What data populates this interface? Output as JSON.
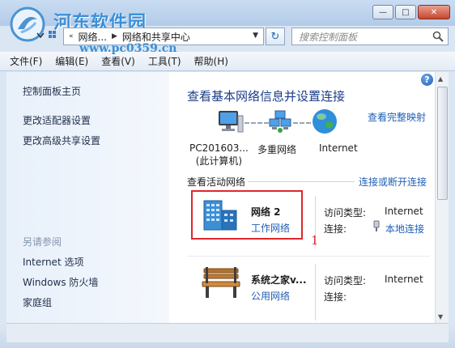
{
  "watermark": {
    "site_name": "河东软件园",
    "url": "www.pc0359.cn"
  },
  "window": {
    "minimize": "—",
    "maximize": "□",
    "close": "✕"
  },
  "address": {
    "segments": [
      "网络...",
      "网络和共享中心"
    ],
    "search_placeholder": "搜索控制面板"
  },
  "menu": [
    "文件(F)",
    "编辑(E)",
    "查看(V)",
    "工具(T)",
    "帮助(H)"
  ],
  "sidebar": {
    "top_links": [
      "控制面板主页",
      "更改适配器设置",
      "更改高级共享设置"
    ],
    "see_also_title": "另请参阅",
    "see_also_links": [
      "Internet 选项",
      "Windows 防火墙",
      "家庭组"
    ]
  },
  "main": {
    "title": "查看基本网络信息并设置连接",
    "full_map_link": "查看完整映射",
    "map_nodes": [
      {
        "label": "PC201603...",
        "sublabel": "(此计算机)"
      },
      {
        "label": "多重网络",
        "sublabel": ""
      },
      {
        "label": "Internet",
        "sublabel": ""
      }
    ],
    "active_header": "查看活动网络",
    "connect_link": "连接或断开连接",
    "networks": [
      {
        "name": "网络  2",
        "type": "工作网络",
        "access_label": "访问类型:",
        "access_value": "Internet",
        "conn_label": "连接:",
        "conn_value": "本地连接"
      },
      {
        "name": "系统之家v...",
        "type": "公用网络",
        "access_label": "访问类型:",
        "access_value": "Internet",
        "conn_label": "连接:",
        "conn_value": ""
      }
    ],
    "annotation": "1"
  },
  "colors": {
    "link": "#1f5fb4",
    "title": "#1b3d8a",
    "highlight": "#e0272b"
  }
}
